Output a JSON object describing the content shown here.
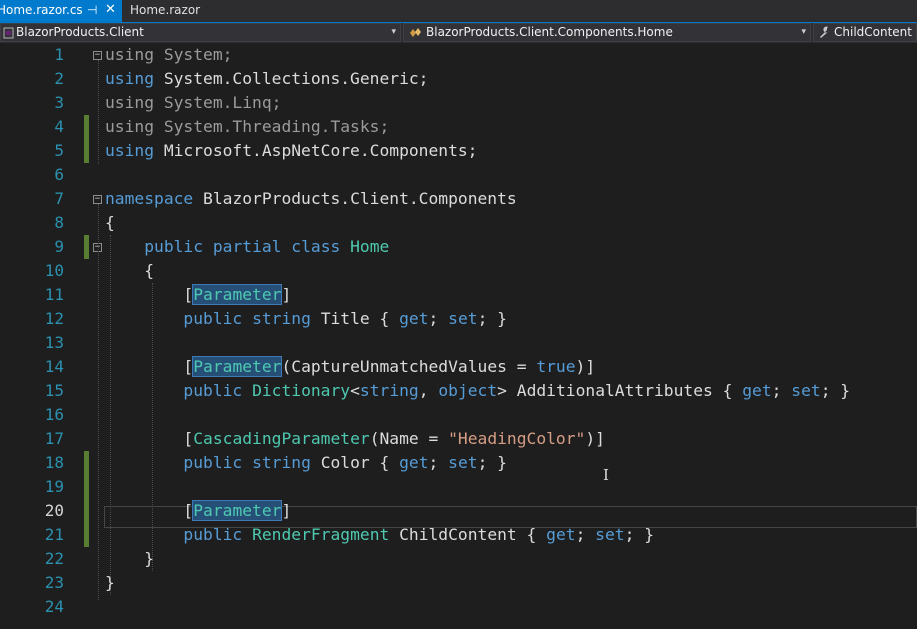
{
  "tabs": {
    "active": {
      "label": "Home.razor.cs",
      "pin_glyph": "⊣",
      "close_glyph": "✕"
    },
    "inactive": {
      "label": "Home.razor"
    }
  },
  "navbar": {
    "project": "BlazorProducts.Client",
    "type": "BlazorProducts.Client.Components.Home",
    "member": "ChildContent",
    "dropdown_glyph": "▾"
  },
  "editor": {
    "current_line": 20,
    "lines": [
      {
        "n": "1",
        "tokens": [
          {
            "t": "using System;",
            "c": "dim"
          }
        ]
      },
      {
        "n": "2",
        "tokens": [
          {
            "t": "using",
            "c": "kw"
          },
          {
            "t": " System.Collections.Generic;"
          }
        ]
      },
      {
        "n": "3",
        "tokens": [
          {
            "t": "using System.Linq;",
            "c": "dim"
          }
        ]
      },
      {
        "n": "4",
        "tokens": [
          {
            "t": "using System.Threading.Tasks;",
            "c": "dim"
          }
        ]
      },
      {
        "n": "5",
        "tokens": [
          {
            "t": "using",
            "c": "kw"
          },
          {
            "t": " Microsoft.AspNetCore.Components;"
          }
        ]
      },
      {
        "n": "6",
        "tokens": []
      },
      {
        "n": "7",
        "tokens": [
          {
            "t": "namespace",
            "c": "kw"
          },
          {
            "t": " BlazorProducts.Client.Components"
          }
        ]
      },
      {
        "n": "8",
        "tokens": [
          {
            "t": "{"
          }
        ]
      },
      {
        "n": "9",
        "tokens": [
          {
            "t": "    "
          },
          {
            "t": "public",
            "c": "kw"
          },
          {
            "t": " "
          },
          {
            "t": "partial",
            "c": "kw"
          },
          {
            "t": " "
          },
          {
            "t": "class",
            "c": "kw"
          },
          {
            "t": " "
          },
          {
            "t": "Home",
            "c": "ty"
          }
        ]
      },
      {
        "n": "10",
        "tokens": [
          {
            "t": "    {"
          }
        ]
      },
      {
        "n": "11",
        "tokens": [
          {
            "t": "        ["
          },
          {
            "t": "Parameter",
            "c": "hl"
          },
          {
            "t": "]"
          }
        ]
      },
      {
        "n": "12",
        "tokens": [
          {
            "t": "        "
          },
          {
            "t": "public",
            "c": "kw"
          },
          {
            "t": " "
          },
          {
            "t": "string",
            "c": "kw"
          },
          {
            "t": " Title { "
          },
          {
            "t": "get",
            "c": "kw"
          },
          {
            "t": "; "
          },
          {
            "t": "set",
            "c": "kw"
          },
          {
            "t": "; }"
          }
        ]
      },
      {
        "n": "13",
        "tokens": []
      },
      {
        "n": "14",
        "tokens": [
          {
            "t": "        ["
          },
          {
            "t": "Parameter",
            "c": "hl"
          },
          {
            "t": "(CaptureUnmatchedValues = "
          },
          {
            "t": "true",
            "c": "kw"
          },
          {
            "t": ")]"
          }
        ]
      },
      {
        "n": "15",
        "tokens": [
          {
            "t": "        "
          },
          {
            "t": "public",
            "c": "kw"
          },
          {
            "t": " "
          },
          {
            "t": "Dictionary",
            "c": "ty"
          },
          {
            "t": "<"
          },
          {
            "t": "string",
            "c": "kw"
          },
          {
            "t": ", "
          },
          {
            "t": "object",
            "c": "kw"
          },
          {
            "t": "> AdditionalAttributes { "
          },
          {
            "t": "get",
            "c": "kw"
          },
          {
            "t": "; "
          },
          {
            "t": "set",
            "c": "kw"
          },
          {
            "t": "; }"
          }
        ]
      },
      {
        "n": "16",
        "tokens": []
      },
      {
        "n": "17",
        "tokens": [
          {
            "t": "        ["
          },
          {
            "t": "CascadingParameter",
            "c": "ty"
          },
          {
            "t": "(Name = "
          },
          {
            "t": "\"HeadingColor\"",
            "c": "st"
          },
          {
            "t": ")]"
          }
        ]
      },
      {
        "n": "18",
        "tokens": [
          {
            "t": "        "
          },
          {
            "t": "public",
            "c": "kw"
          },
          {
            "t": " "
          },
          {
            "t": "string",
            "c": "kw"
          },
          {
            "t": " Color { "
          },
          {
            "t": "get",
            "c": "kw"
          },
          {
            "t": "; "
          },
          {
            "t": "set",
            "c": "kw"
          },
          {
            "t": "; }"
          }
        ]
      },
      {
        "n": "19",
        "tokens": []
      },
      {
        "n": "20",
        "tokens": [
          {
            "t": "        ["
          },
          {
            "t": "Parameter",
            "c": "hl"
          },
          {
            "t": "]"
          }
        ]
      },
      {
        "n": "21",
        "tokens": [
          {
            "t": "        "
          },
          {
            "t": "public",
            "c": "kw"
          },
          {
            "t": " "
          },
          {
            "t": "RenderFragment",
            "c": "ty"
          },
          {
            "t": " ChildContent { "
          },
          {
            "t": "get",
            "c": "kw"
          },
          {
            "t": "; "
          },
          {
            "t": "set",
            "c": "kw"
          },
          {
            "t": "; }"
          }
        ]
      },
      {
        "n": "22",
        "tokens": [
          {
            "t": "    }"
          }
        ]
      },
      {
        "n": "23",
        "tokens": [
          {
            "t": "}"
          }
        ]
      },
      {
        "n": "24",
        "tokens": []
      }
    ]
  },
  "icons": {
    "fold_glyph": "−",
    "cursor_glyph": "I",
    "project_icon": "csharp-project-icon",
    "type_icon": "class-icon",
    "member_icon": "wrench-icon"
  }
}
